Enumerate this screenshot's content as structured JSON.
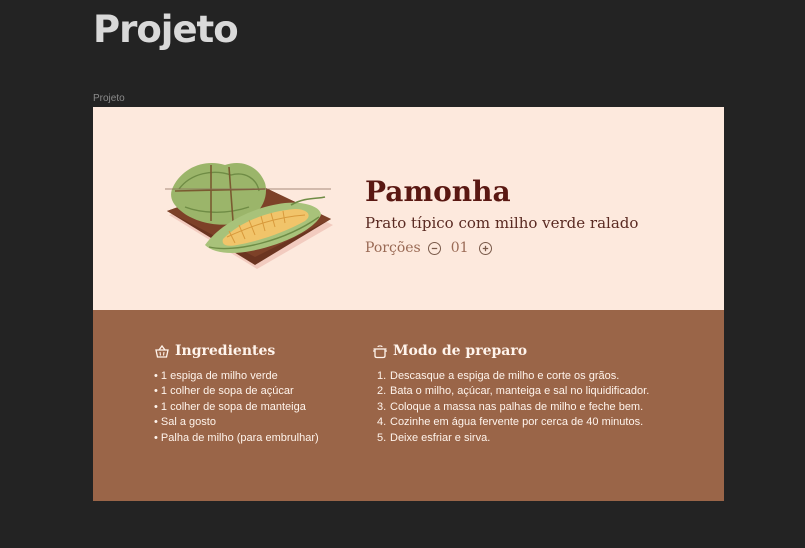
{
  "page": {
    "title": "Projeto",
    "frame_label": "Projeto"
  },
  "recipe": {
    "title": "Pamonha",
    "subtitle": "Prato típico com milho verde ralado",
    "servings_label": "Porções",
    "servings_value": "01"
  },
  "ingredients": {
    "heading": "Ingredientes",
    "icon": "basket-icon",
    "items": [
      "1 espiga de milho verde",
      "1 colher de sopa de açúcar",
      "1 colher de sopa de manteiga",
      "Sal a gosto",
      "Palha de milho (para embrulhar)"
    ]
  },
  "preparation": {
    "heading": "Modo de preparo",
    "icon": "cooking-pot-icon",
    "steps": [
      {
        "num": "1.",
        "text": "Descasque a espiga de milho e corte os grãos."
      },
      {
        "num": "2.",
        "text": "Bata o milho, açúcar, manteiga e sal no liquidificador."
      },
      {
        "num": "3.",
        "text": "Coloque a massa nas palhas de milho e feche bem."
      },
      {
        "num": "4.",
        "text": "Cozinhe em água fervente por cerca de 40 minutos."
      },
      {
        "num": "5.",
        "text": "Deixe esfriar e sirva."
      }
    ]
  },
  "colors": {
    "canvas": "#232323",
    "hero_bg": "#fde9dd",
    "details_bg": "#9a6548",
    "title": "#5a1812"
  }
}
